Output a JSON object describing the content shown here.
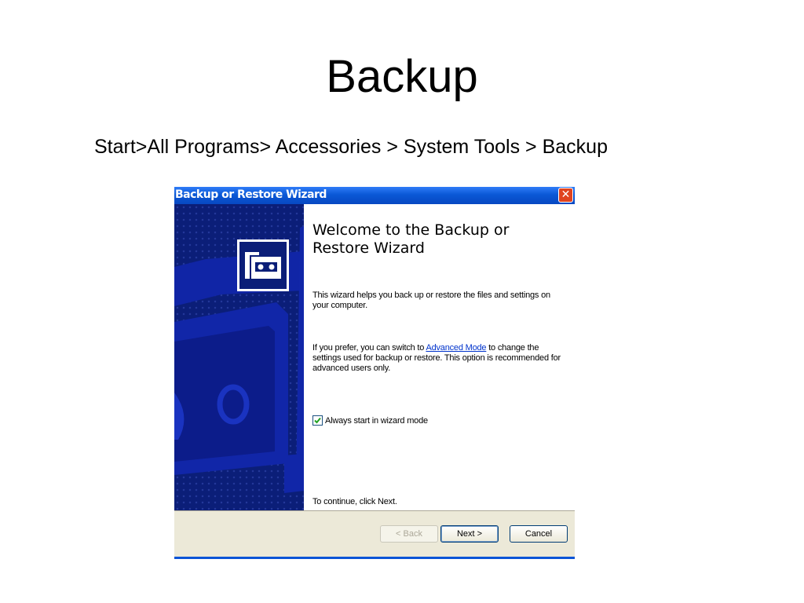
{
  "slide": {
    "title": "Backup",
    "path": "Start>All Programs> Accessories > System Tools > Backup"
  },
  "window": {
    "title": "Backup or Restore Wizard",
    "close_glyph": "✕"
  },
  "wizard": {
    "heading": "Welcome to the Backup or Restore Wizard",
    "intro": "This wizard helps you back up or restore the files and settings on your computer.",
    "advanced_prefix": "If you prefer, you can switch to ",
    "advanced_link": "Advanced Mode",
    "advanced_suffix": " to change the settings used for backup or restore. This option is recommended for advanced users only.",
    "checkbox_label": "Always start in wizard mode",
    "checkbox_checked": true,
    "continue_text": "To continue, click Next."
  },
  "buttons": {
    "back": "< Back",
    "next": "Next >",
    "cancel": "Cancel"
  },
  "colors": {
    "side_panel": "#0b1e78",
    "titlebar": "#0a58d6",
    "link": "#0033cc"
  },
  "icons": {
    "logo": "backup-tape-icon",
    "close": "close-icon",
    "check": "checkmark-icon"
  }
}
